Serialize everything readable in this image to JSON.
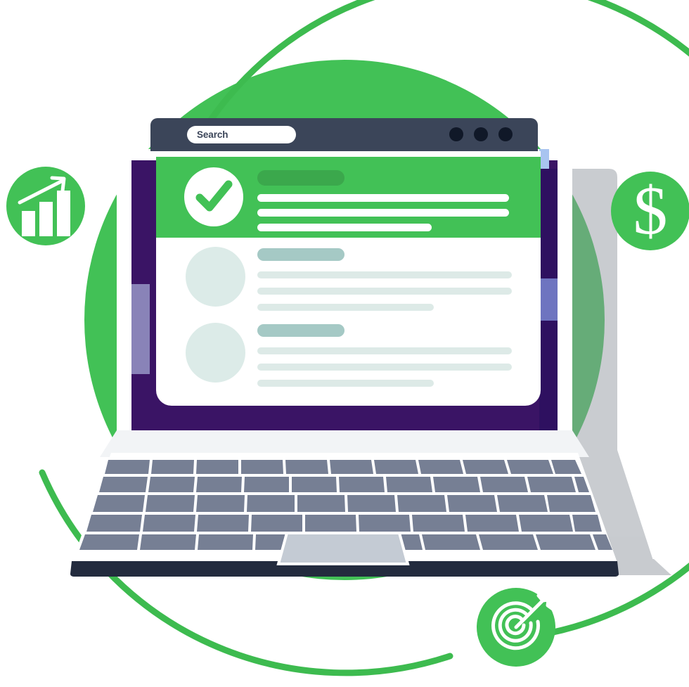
{
  "illustration": {
    "title": "Laptop with success notification",
    "background_shapes": {
      "solid_circle_color": "#42c156",
      "outer_ring_color": "#3dbb4f",
      "inner_ring_color": "#3dbb4f"
    }
  },
  "browser": {
    "bar_color": "#3b4559",
    "search": {
      "label": "Search",
      "placeholder": "Search",
      "value": "Search"
    },
    "window_dots": [
      {
        "name": "window-dot-1",
        "color": "#101828"
      },
      {
        "name": "window-dot-2",
        "color": "#101828"
      },
      {
        "name": "window-dot-3",
        "color": "#101828"
      }
    ]
  },
  "screen": {
    "bezel_color": "#3a1465",
    "accent_left_top_color": "#3a1465",
    "accent_left_mid_color": "#8983b8",
    "accent_right_top_color": "#a8c4f0",
    "accent_right_mid_color": "#6e74c0",
    "card_background": "#ffffff"
  },
  "hero_banner": {
    "background": "#42c156",
    "icon": "check-circle-icon",
    "icon_circle_color": "#ffffff",
    "icon_check_color": "#42c156",
    "title_placeholder_color": "#3ba84c",
    "line_color": "#ffffff",
    "lines": [
      "full",
      "full",
      "short"
    ]
  },
  "list": {
    "avatar_color": "#dcebe8",
    "title_placeholder_color": "#a5c9c5",
    "line_color": "#ddeae7",
    "rows": [
      {
        "name": "list-item-1",
        "lines": [
          "full",
          "full",
          "short"
        ]
      },
      {
        "name": "list-item-2",
        "lines": [
          "full",
          "full",
          "short"
        ]
      }
    ]
  },
  "laptop": {
    "body_color": "#ffffff",
    "base_edge_color": "#232b3e",
    "key_color": "#767f94",
    "key_rows": 5,
    "trackpad_color": "#c4cbd4",
    "shadow_color": "#a9aeb5"
  },
  "badges": [
    {
      "name": "badge-growth-chart",
      "icon": "bar-chart-arrow-icon",
      "circle_color": "#42c156",
      "glyph_color": "#ffffff",
      "position": "left"
    },
    {
      "name": "badge-dollar",
      "icon": "dollar-sign-icon",
      "label": "$",
      "circle_color": "#42c156",
      "glyph_color": "#ffffff",
      "position": "right"
    },
    {
      "name": "badge-target",
      "icon": "target-dart-icon",
      "circle_color": "#42c156",
      "glyph_color": "#ffffff",
      "position": "bottom"
    }
  ]
}
